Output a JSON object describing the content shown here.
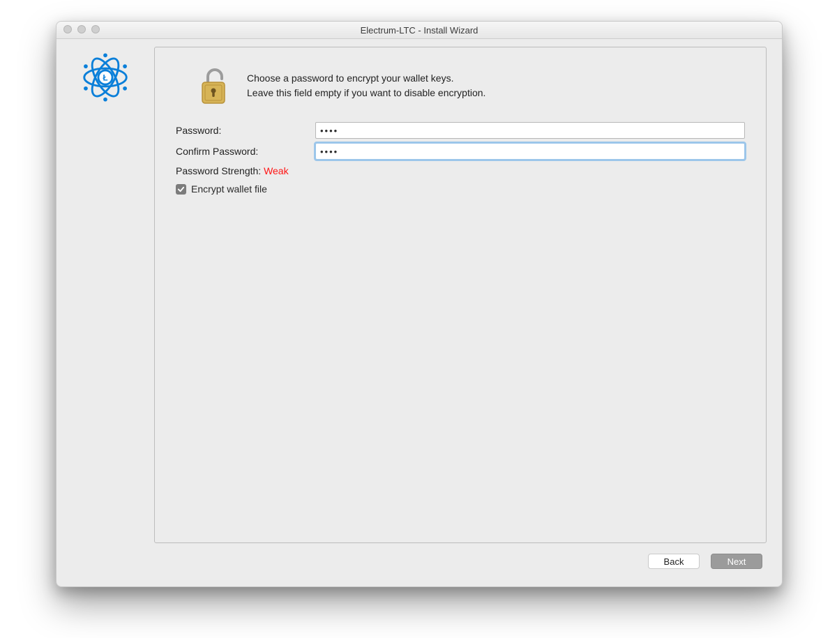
{
  "window": {
    "title": "Electrum-LTC  -  Install Wizard"
  },
  "intro": {
    "line1": "Choose a password to encrypt your wallet keys.",
    "line2": "Leave this field empty if you want to disable encryption."
  },
  "form": {
    "password_label": "Password:",
    "password_value": "••••",
    "confirm_label": "Confirm Password:",
    "confirm_value": "••••",
    "strength_label": "Password Strength: ",
    "strength_value": "Weak",
    "strength_color": "#ff1414",
    "encrypt_checkbox_label": "Encrypt wallet file",
    "encrypt_checked": true
  },
  "buttons": {
    "back": "Back",
    "next": "Next"
  }
}
